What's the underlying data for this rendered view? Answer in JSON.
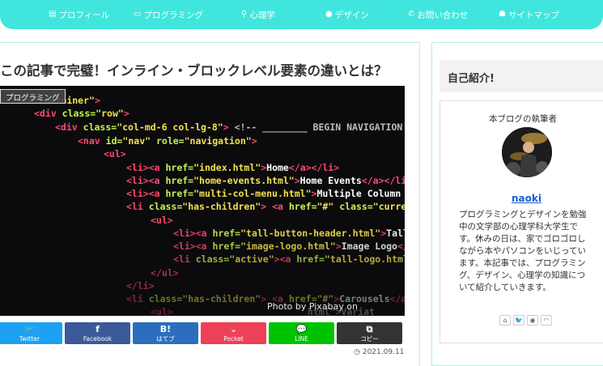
{
  "nav": {
    "items": [
      {
        "icon": "id-card-icon",
        "label": "プロフィール"
      },
      {
        "icon": "monitor-icon",
        "label": "プログラミング"
      },
      {
        "icon": "brain-icon",
        "label": "心理学"
      },
      {
        "icon": "palette-icon",
        "label": "デザイン"
      },
      {
        "icon": "phone-icon",
        "label": "お問い合わせ"
      },
      {
        "icon": "sitemap-icon",
        "label": "サイトマップ"
      }
    ]
  },
  "article": {
    "title": "この記事で完璧！インライン・ブロックレベル要素の違いとは？",
    "category": "プログラミング",
    "image_credit": "Photo by Pixabay on",
    "date": "2021.09.11"
  },
  "share": [
    {
      "icon": "twitter-icon",
      "glyph": "🐦",
      "label": "Twitter",
      "color": "#1da1f2"
    },
    {
      "icon": "facebook-icon",
      "glyph": "f",
      "label": "Facebook",
      "color": "#3b5998"
    },
    {
      "icon": "hatena-icon",
      "glyph": "B!",
      "label": "はてブ",
      "color": "#2c6ebd"
    },
    {
      "icon": "pocket-icon",
      "glyph": "⌄",
      "label": "Pocket",
      "color": "#ee4056"
    },
    {
      "icon": "line-icon",
      "glyph": "💬",
      "label": "LINE",
      "color": "#00c300"
    },
    {
      "icon": "copy-icon",
      "glyph": "⧉",
      "label": "コピー",
      "color": "#333333"
    }
  ],
  "sidebar": {
    "heading": "自己紹介!",
    "profile_label": "本ブログの執筆者",
    "name": "naoki",
    "description": "プログラミングとデザインを勉強中の文学部の心理学科大学生です。休みの日は、家でゴロゴロしながら本やパソコンをいじっています。本記事では、プログラミング、デザイン、心理学の知識について紹介していきます。",
    "social": [
      "home-icon",
      "twitter-icon",
      "pocket-icon",
      "rss-icon"
    ]
  },
  "colors": {
    "accent": "#40e6dd",
    "border": "#b7ebe8"
  }
}
